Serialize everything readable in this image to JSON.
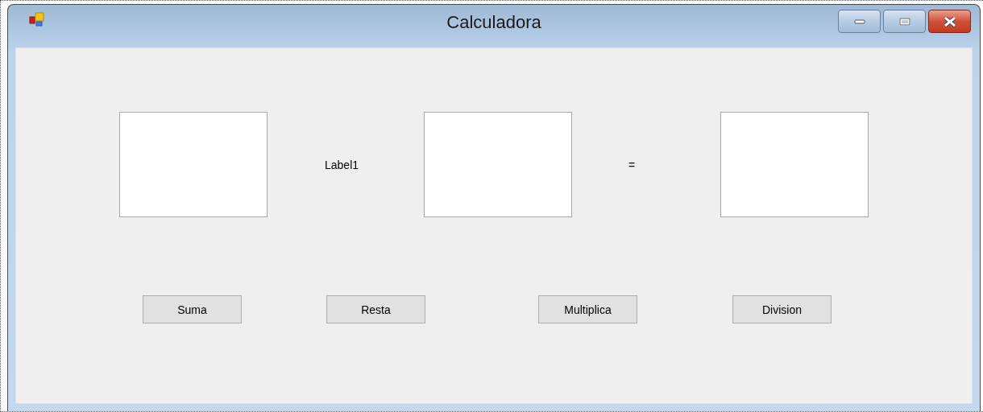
{
  "window": {
    "title": "Calculadora"
  },
  "fields": [
    {
      "kind": "textbox"
    },
    {
      "kind": "textbox"
    },
    {
      "kind": "textbox"
    }
  ],
  "operator_label": "Label1",
  "equals_label": "=",
  "buttons": [
    "Suma",
    "Resta",
    "Multiplica",
    "Division"
  ]
}
